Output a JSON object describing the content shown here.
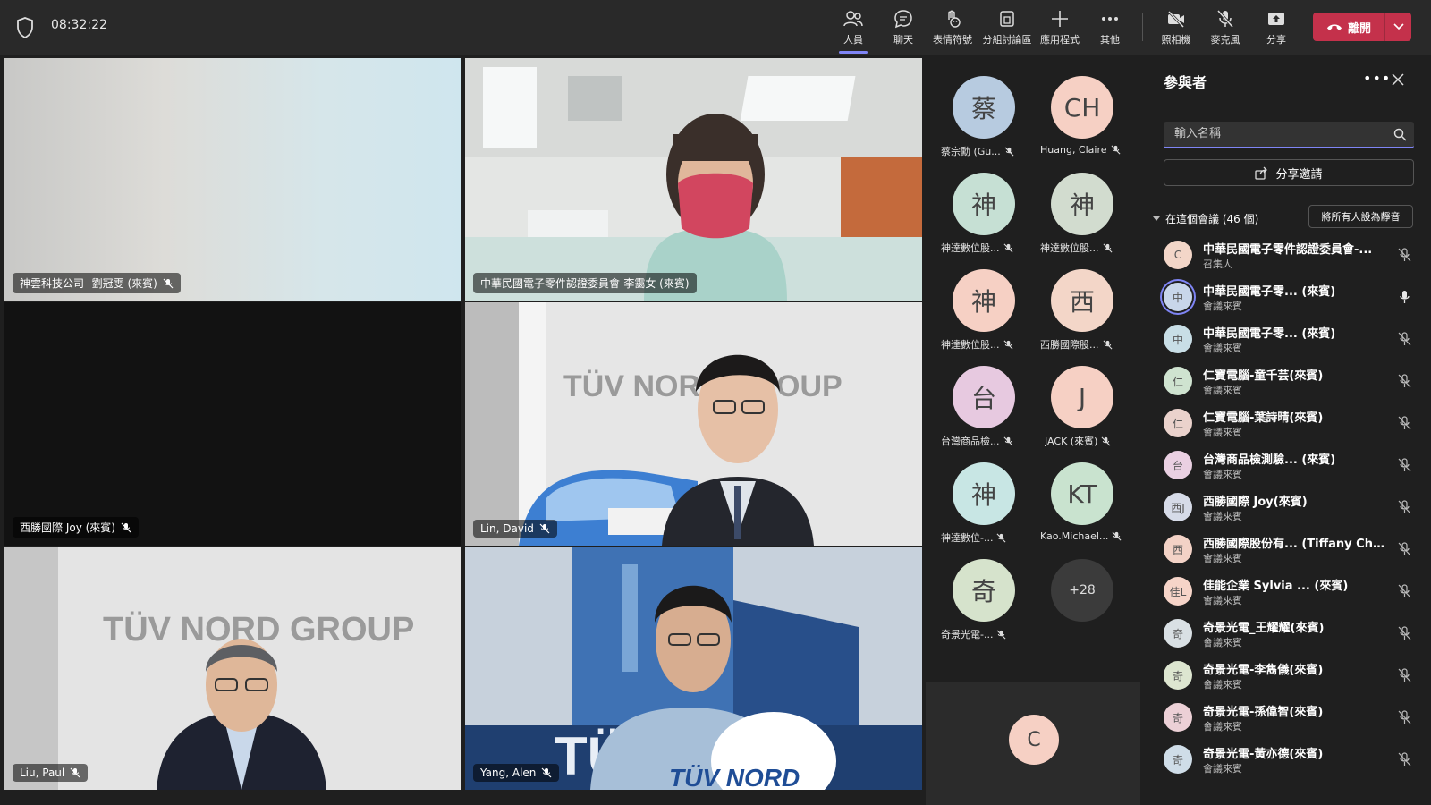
{
  "clock": "08:32:22",
  "toolbar": {
    "people": "人員",
    "chat": "聊天",
    "reactions": "表情符號",
    "rooms": "分組討論區",
    "apps": "應用程式",
    "more": "其他",
    "camera": "照相機",
    "mic": "麥克風",
    "share": "分享",
    "leave": "離開"
  },
  "tiles": [
    {
      "name": "神雲科技公司--劉冠雯 (來賓)"
    },
    {
      "name": "中華民國電子零件認證委員會-李靄女 (來賓)"
    },
    {
      "name": "西勝國際 Joy (來賓)"
    },
    {
      "name": "Lin, David"
    },
    {
      "name": "Liu, Paul"
    },
    {
      "name": "Yang, Alen"
    }
  ],
  "roster": [
    {
      "initial": "蔡",
      "name": "蔡宗勳 (Gu...",
      "color": "#b7cbe0"
    },
    {
      "initial": "CH",
      "name": "Huang, Claire",
      "color": "#f6d0c4"
    },
    {
      "initial": "神",
      "name": "神達數位股...",
      "color": "#c6e0d4"
    },
    {
      "initial": "神",
      "name": "神達數位股...",
      "color": "#d2dccf"
    },
    {
      "initial": "神",
      "name": "神達數位股...",
      "color": "#f6d0c4"
    },
    {
      "initial": "西",
      "name": "西勝國際股...",
      "color": "#f3d6c8"
    },
    {
      "initial": "台",
      "name": "台灣商品檢...",
      "color": "#e7c9e0"
    },
    {
      "initial": "J",
      "name": "JACK (來賓)",
      "color": "#f6d0c4"
    },
    {
      "initial": "神",
      "name": "神達數位-...",
      "color": "#c8e6e4"
    },
    {
      "initial": "KT",
      "name": "Kao.Michael...",
      "color": "#c9e3cf"
    },
    {
      "initial": "奇",
      "name": "奇景光電-...",
      "color": "#d6e3cc"
    }
  ],
  "roster_more": "+28",
  "self_initial": "C",
  "panel": {
    "title": "參與者",
    "search_placeholder": "輸入名稱",
    "share_invite": "分享邀請",
    "section": "在這個會議 (46 個)",
    "mute_all": "將所有人設為靜音",
    "people": [
      {
        "initial": "C",
        "name": "中華民國電子零件認證委員會-...",
        "role": "召集人",
        "color": "#f3d6c8",
        "mic": "muted"
      },
      {
        "initial": "中",
        "name": "中華民國電子零... (來賓)",
        "role": "會議來賓",
        "color": "#c8d6ea",
        "mic": "on"
      },
      {
        "initial": "中",
        "name": "中華民國電子零... (來賓)",
        "role": "會議來賓",
        "color": "#c8dee6",
        "mic": "muted"
      },
      {
        "initial": "仁",
        "name": "仁寶電腦-童千芸(來賓)",
        "role": "會議來賓",
        "color": "#cfe3d0",
        "mic": "muted"
      },
      {
        "initial": "仁",
        "name": "仁寶電腦-葉詩晴(來賓)",
        "role": "會議來賓",
        "color": "#ead2cc",
        "mic": "muted"
      },
      {
        "initial": "台",
        "name": "台灣商品檢測驗... (來賓)",
        "role": "會議來賓",
        "color": "#ead0e2",
        "mic": "muted"
      },
      {
        "initial": "西J",
        "name": "西勝國際 Joy(來賓)",
        "role": "會議來賓",
        "color": "#d6dbe8",
        "mic": "muted"
      },
      {
        "initial": "西",
        "name": "西勝國際股份有... (Tiffany Chen...",
        "role": "會議來賓",
        "color": "#f3d2c6",
        "mic": "muted"
      },
      {
        "initial": "佳L",
        "name": "佳能企業 Sylvia ... (來賓)",
        "role": "會議來賓",
        "color": "#f6d4c8",
        "mic": "muted"
      },
      {
        "initial": "奇",
        "name": "奇景光電_王耀耀(來賓)",
        "role": "會議來賓",
        "color": "#d9e0e4",
        "mic": "muted"
      },
      {
        "initial": "奇",
        "name": "奇景光電-李雋儀(來賓)",
        "role": "會議來賓",
        "color": "#dde6d0",
        "mic": "muted"
      },
      {
        "initial": "奇",
        "name": "奇景光電-孫偉智(來賓)",
        "role": "會議來賓",
        "color": "#ecd0d6",
        "mic": "muted"
      },
      {
        "initial": "奇",
        "name": "奇景光電-黃亦德(來賓)",
        "role": "會議來賓",
        "color": "#cfdde8",
        "mic": "muted"
      }
    ]
  },
  "colors": {
    "accent": "#7f85f5",
    "leave": "#c4314b",
    "bg": "#1f1f1f"
  }
}
